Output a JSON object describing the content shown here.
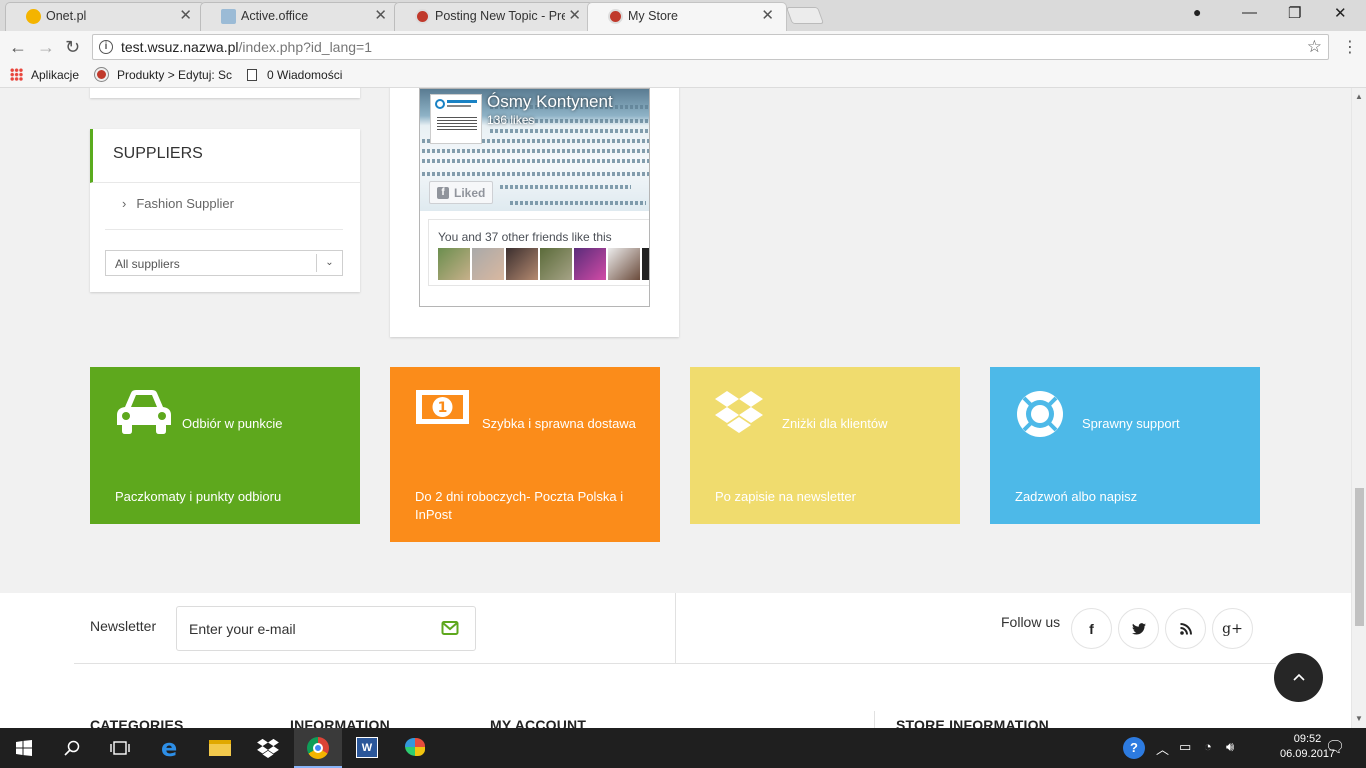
{
  "browser": {
    "tabs": [
      {
        "title": "Onet.pl",
        "close": "✕"
      },
      {
        "title": "Active.office",
        "close": "✕"
      },
      {
        "title": "Posting New Topic - Pres",
        "close": "✕"
      },
      {
        "title": "My Store",
        "close": "✕"
      }
    ],
    "window_controls": {
      "minimize": "—",
      "maximize": "❐",
      "close": "✕"
    },
    "url_host": "test.wsuz.nazwa.pl",
    "url_path": "/index.php?id_lang=1",
    "bookmarks": [
      {
        "label": "Aplikacje",
        "icon": "apps-grid-icon"
      },
      {
        "label": "Produkty > Edytuj: Sc",
        "icon": "prestashop-icon"
      },
      {
        "label": "0 Wiadomości",
        "icon": "page-icon"
      }
    ]
  },
  "suppliers": {
    "heading": "SUPPLIERS",
    "items": [
      {
        "label": "Fashion Supplier"
      }
    ],
    "select_value": "All suppliers"
  },
  "facebook": {
    "page_name": "Ósmy Kontynent",
    "likes": "136 likes",
    "liked_button": "Liked",
    "friends_text": "You and 37 other friends like this"
  },
  "features": [
    {
      "title": "Odbiór w punkcie",
      "desc": "Paczkomaty i punkty odbioru",
      "color": "#5ea81d",
      "icon": "car-icon"
    },
    {
      "title": "Szybka i sprawna dostawa",
      "desc": "Do 2 dni roboczych- Poczta Polska i InPost",
      "color": "#fb8c1a",
      "icon": "money-icon"
    },
    {
      "title": "Zniżki dla klientów",
      "desc": "Po zapisie na newsletter",
      "color": "#f0dc6e",
      "icon": "dropbox-icon"
    },
    {
      "title": "Sprawny support",
      "desc": "Zadzwoń albo napisz",
      "color": "#4db9e8",
      "icon": "lifebuoy-icon"
    }
  ],
  "newsletter": {
    "label": "Newsletter",
    "placeholder": "Enter your e-mail",
    "follow_label": "Follow us",
    "social": [
      {
        "icon": "facebook-icon",
        "glyph": "f"
      },
      {
        "icon": "twitter-icon",
        "glyph": "🐦"
      },
      {
        "icon": "rss-icon",
        "glyph": "◉"
      },
      {
        "icon": "google-plus-icon",
        "glyph": "g+"
      }
    ]
  },
  "footer": {
    "columns": [
      "CATEGORIES",
      "INFORMATION",
      "MY ACCOUNT",
      "STORE INFORMATION"
    ]
  },
  "taskbar": {
    "time": "09:52",
    "date": "06.09.2017"
  }
}
